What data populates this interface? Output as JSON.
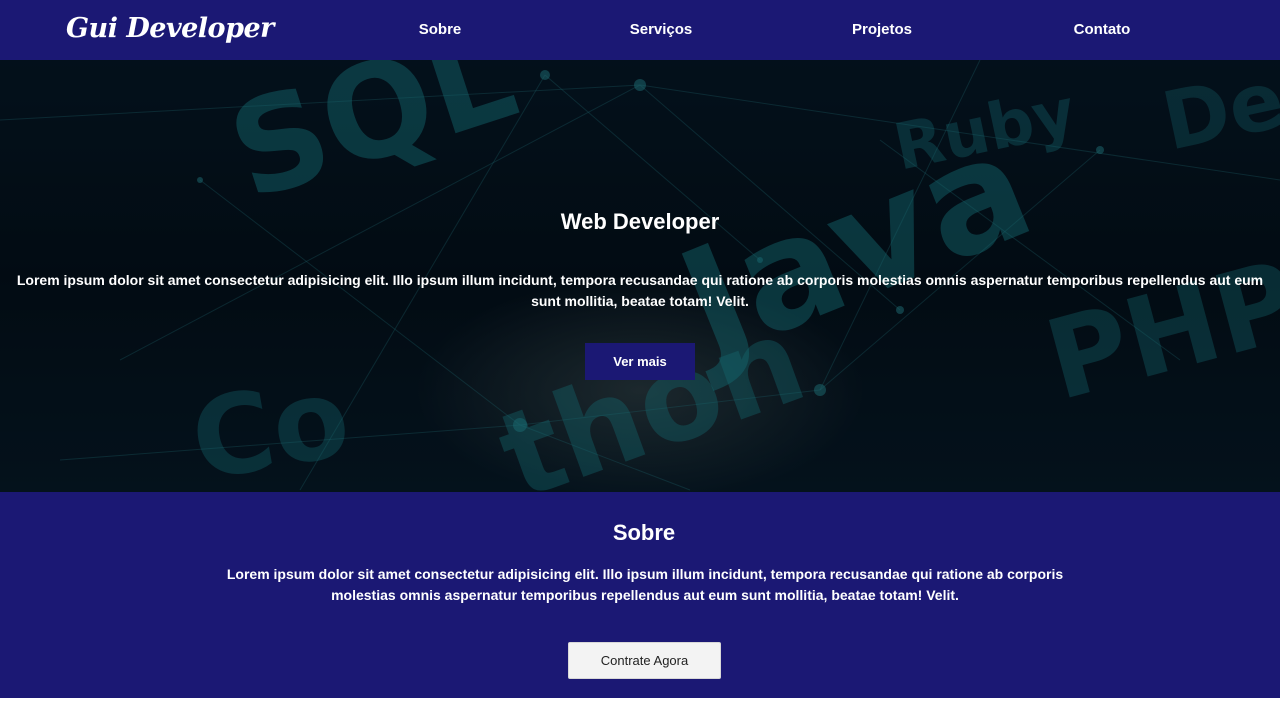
{
  "header": {
    "logo": "Gui Developer",
    "nav": [
      "Sobre",
      "Serviços",
      "Projetos",
      "Contato"
    ]
  },
  "hero": {
    "title": "Web Developer",
    "text": "Lorem ipsum dolor sit amet consectetur adipisicing elit. Illo ipsum illum incidunt, tempora recusandae qui ratione ab corporis molestias omnis aspernatur temporibus repellendus aut eum sunt mollitia, beatae totam! Velit.",
    "button": "Ver mais",
    "background_words": [
      "SQL",
      "Ruby",
      "Java",
      "PHP",
      "Co",
      "thon",
      "De"
    ]
  },
  "about": {
    "title": "Sobre",
    "text": "Lorem ipsum dolor sit amet consectetur adipisicing elit. Illo ipsum illum incidunt, tempora recusandae qui ratione ab corporis molestias omnis aspernatur temporibus repellendus aut eum sunt mollitia, beatae totam! Velit.",
    "button": "Contrate Agora"
  },
  "colors": {
    "brand": "#1b1874",
    "button_light": "#f3f3f3"
  }
}
